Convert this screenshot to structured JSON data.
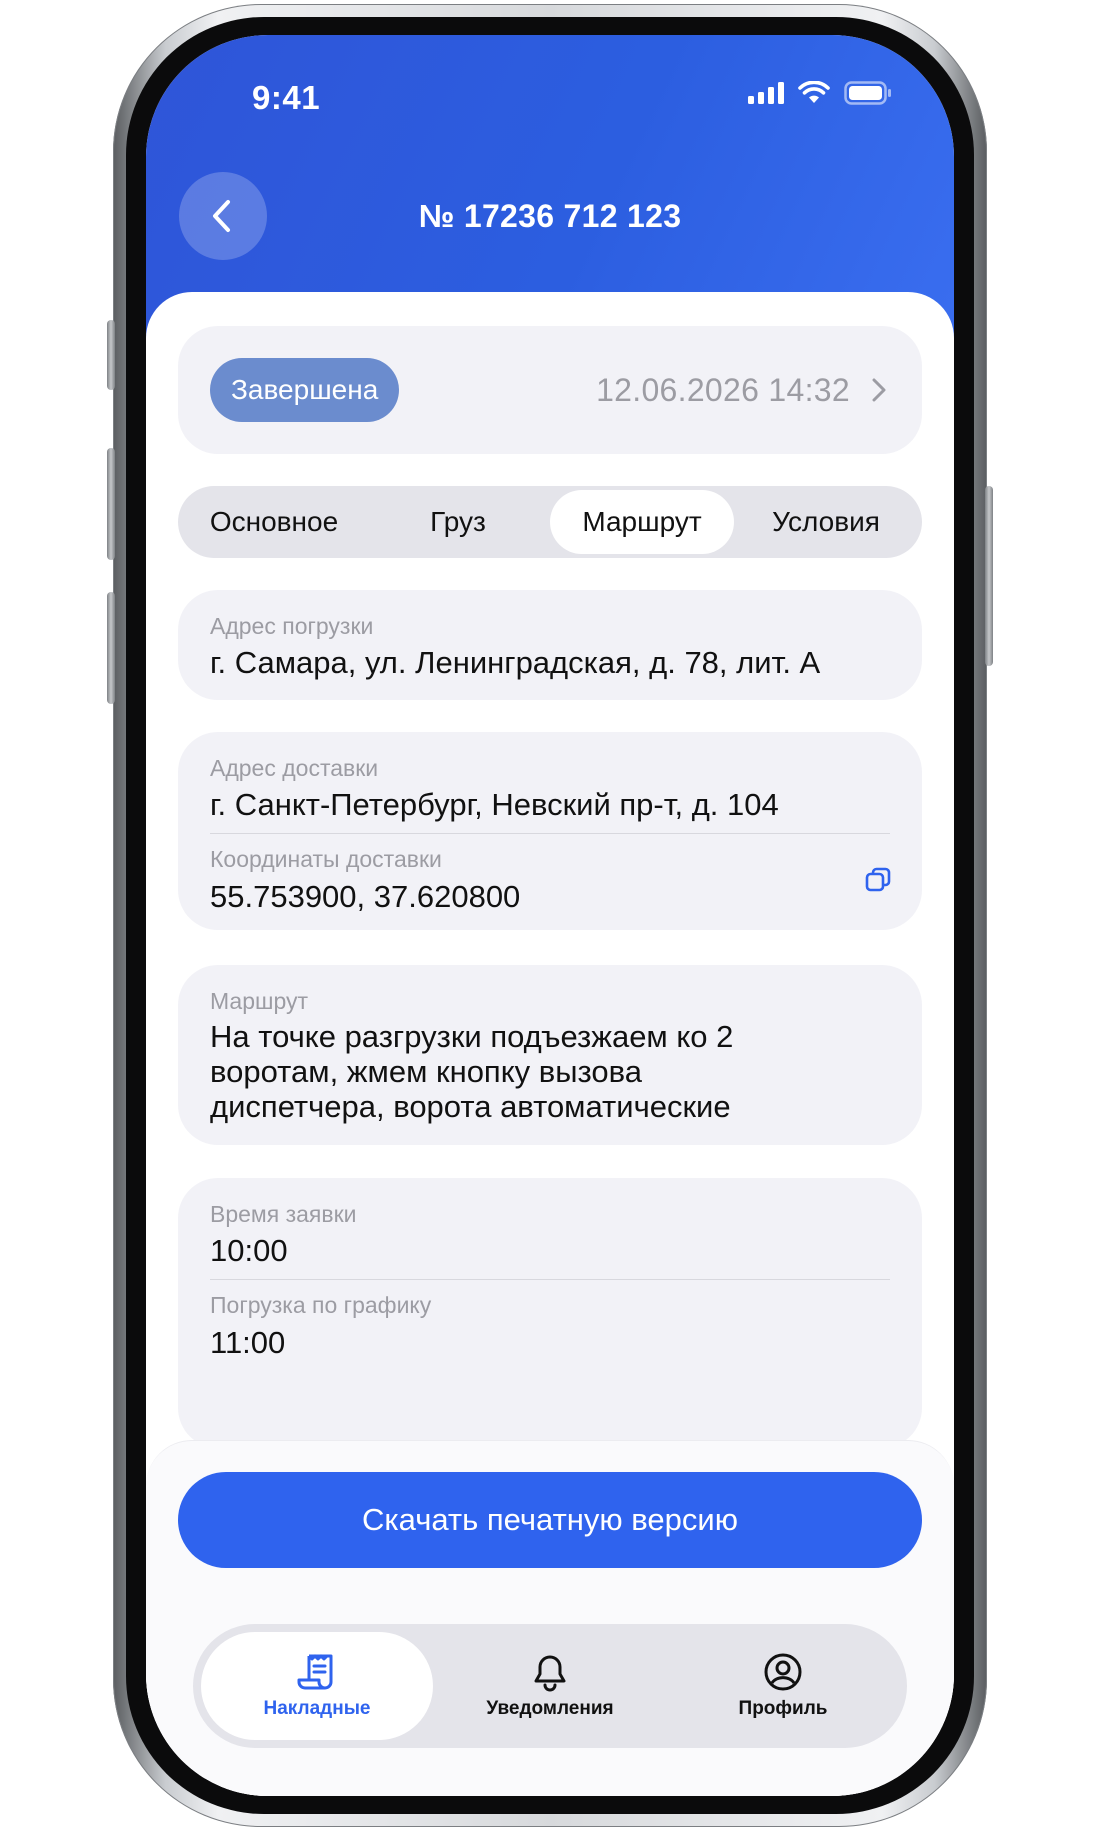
{
  "status_bar": {
    "time": "9:41"
  },
  "header": {
    "title": "№ 17236 712 123"
  },
  "status_card": {
    "badge": "Завершена",
    "datetime": "12.06.2026 14:32"
  },
  "tabs": [
    {
      "label": "Основное"
    },
    {
      "label": "Груз"
    },
    {
      "label": "Маршрут",
      "active": true
    },
    {
      "label": "Условия"
    }
  ],
  "loading": {
    "label": "Адрес погрузки",
    "value": "г. Самара, ул. Ленинградская, д. 78, лит. А"
  },
  "delivery": {
    "address_label": "Адрес доставки",
    "address_value": "г. Санкт-Петербург, Невский пр-т, д. 104",
    "coords_label": "Координаты доставки",
    "coords_value": "55.753900, 37.620800"
  },
  "route": {
    "label": "Маршрут",
    "lines": [
      "На точке разгрузки подъезжаем ко 2",
      "воротам, жмем кнопку вызова",
      "диспетчера, ворота автоматические"
    ]
  },
  "times": {
    "request_label": "Время заявки",
    "request_value": "10:00",
    "schedule_label": "Погрузка по графику",
    "schedule_value": "11:00"
  },
  "download_button": {
    "label": "Скачать печатную версию"
  },
  "tab_bar": [
    {
      "label": "Накладные",
      "icon": "receipt-icon",
      "active": true
    },
    {
      "label": "Уведомления",
      "icon": "bell-icon"
    },
    {
      "label": "Профиль",
      "icon": "user-circle-icon"
    }
  ],
  "colors": {
    "header": "#2f55d8",
    "accent": "#2f63ee",
    "badge": "#6b8cce",
    "card": "#f2f2f7"
  }
}
